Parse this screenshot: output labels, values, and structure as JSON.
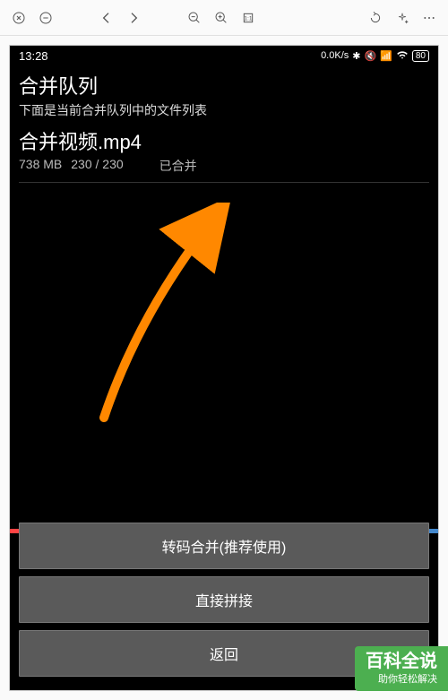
{
  "status_bar": {
    "time": "13:28",
    "speed": "0.0K/s",
    "battery": "80"
  },
  "page": {
    "title": "合并队列",
    "subtitle": "下面是当前合并队列中的文件列表"
  },
  "file": {
    "name": "合并视频.mp4",
    "size": "738 MB",
    "progress": "230 / 230",
    "status": "已合并"
  },
  "buttons": {
    "transcode": "转码合并(推荐使用)",
    "direct": "直接拼接",
    "back": "返回"
  },
  "watermark": {
    "title": "百科全说",
    "subtitle": "助你轻松解决"
  },
  "annotation_color": "#ff8800"
}
